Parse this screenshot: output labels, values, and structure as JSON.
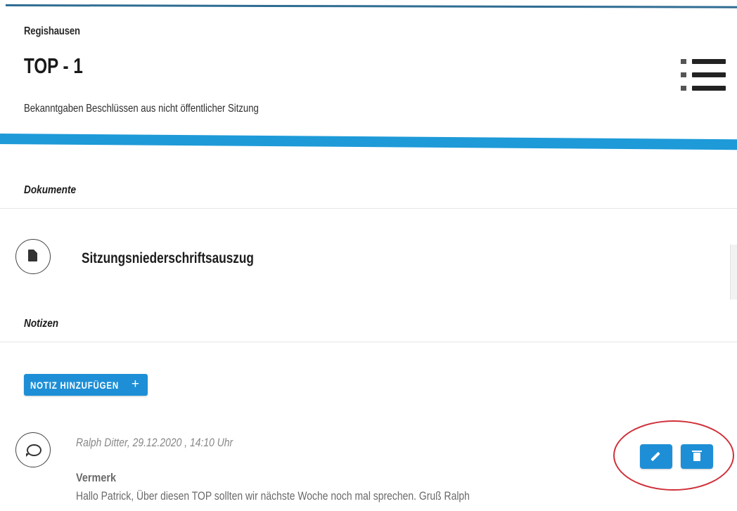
{
  "header": {
    "org": "Regishausen",
    "title": "TOP - 1",
    "subtitle": "Bekanntgaben Beschlüssen aus nicht öffentlicher Sitzung"
  },
  "icons": {
    "menu": "list-menu-icon",
    "document": "document-icon",
    "note": "comment-icon",
    "edit": "pencil-icon",
    "delete": "trash-icon"
  },
  "colors": {
    "accent": "#1e9ad8",
    "button": "#1e8fd6",
    "header_line": "#2f6d93",
    "highlight": "#d0303a"
  },
  "documents": {
    "section_label": "Dokumente",
    "items": [
      {
        "name": "Sitzungsniederschriftsauszug"
      }
    ]
  },
  "notes": {
    "section_label": "Notizen",
    "add_label": "NOTIZ HINZUFÜGEN",
    "add_symbol": "+",
    "items": [
      {
        "meta": "Ralph Ditter, 29.12.2020 , 14:10 Uhr",
        "title": "Vermerk",
        "text": "Hallo Patrick, Über diesen TOP sollten wir nächste Woche noch mal sprechen. Gruß Ralph"
      }
    ]
  }
}
